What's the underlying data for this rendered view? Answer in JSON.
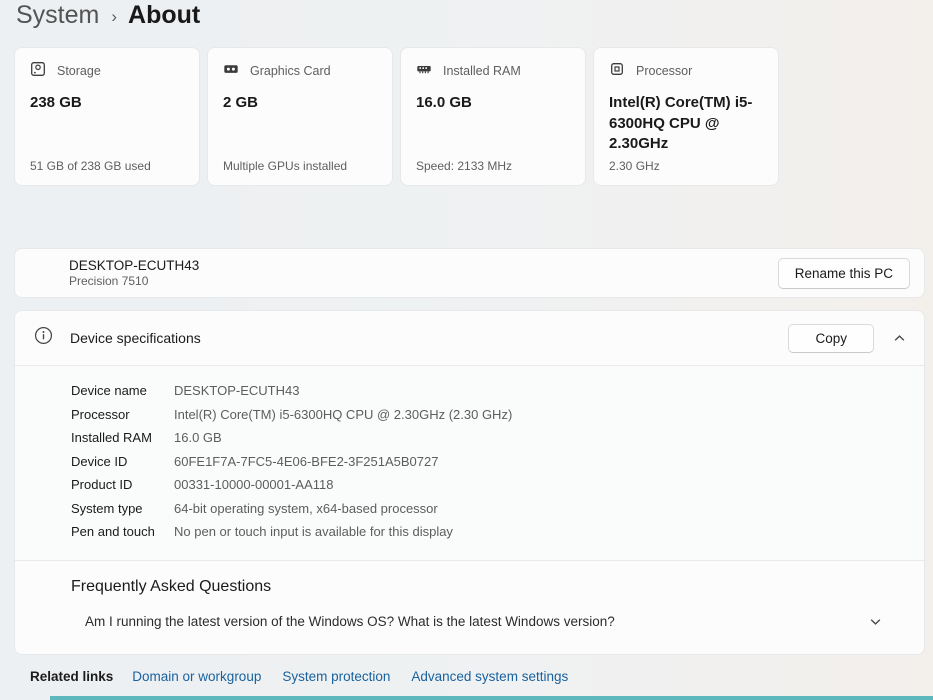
{
  "breadcrumb": {
    "parent": "System",
    "separator": "›",
    "current": "About"
  },
  "cards": [
    {
      "icon": "storage-icon",
      "label": "Storage",
      "value": "238 GB",
      "footer": "51 GB of 238 GB used"
    },
    {
      "icon": "graphics-card-icon",
      "label": "Graphics Card",
      "value": "2 GB",
      "footer": "Multiple GPUs installed"
    },
    {
      "icon": "ram-icon",
      "label": "Installed RAM",
      "value": "16.0 GB",
      "footer": "Speed: 2133 MHz"
    },
    {
      "icon": "processor-icon",
      "label": "Processor",
      "value": "Intel(R) Core(TM) i5-6300HQ CPU @ 2.30GHz",
      "footer": "2.30 GHz"
    }
  ],
  "device": {
    "name": "DESKTOP-ECUTH43",
    "model": "Precision 7510",
    "rename_button": "Rename this PC"
  },
  "specs": {
    "title": "Device specifications",
    "copy_button": "Copy",
    "rows": [
      {
        "label": "Device name",
        "value": "DESKTOP-ECUTH43"
      },
      {
        "label": "Processor",
        "value": "Intel(R) Core(TM) i5-6300HQ CPU @ 2.30GHz (2.30 GHz)"
      },
      {
        "label": "Installed RAM",
        "value": "16.0 GB"
      },
      {
        "label": "Device ID",
        "value": "60FE1F7A-7FC5-4E06-BFE2-3F251A5B0727"
      },
      {
        "label": "Product ID",
        "value": "00331-10000-00001-AA118"
      },
      {
        "label": "System type",
        "value": "64-bit operating system, x64-based processor"
      },
      {
        "label": "Pen and touch",
        "value": "No pen or touch input is available for this display"
      }
    ]
  },
  "faq": {
    "title": "Frequently Asked Questions",
    "question": "Am I running the latest version of the Windows OS? What is the latest Windows version?"
  },
  "related": {
    "title": "Related links",
    "links": [
      "Domain or workgroup",
      "System protection",
      "Advanced system settings"
    ]
  },
  "colors": {
    "link": "#19629f",
    "bottom_bar": "#5db8be",
    "card_bg": "#fcfcfd"
  }
}
